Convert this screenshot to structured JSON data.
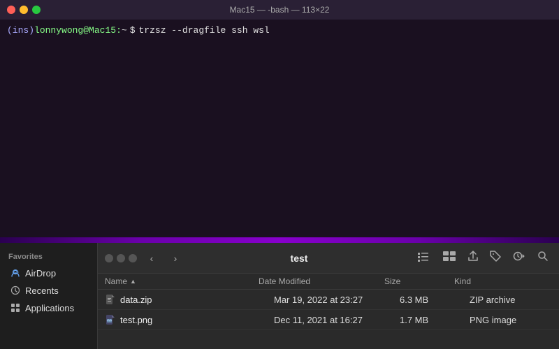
{
  "terminal": {
    "title": "Mac15 — -bash — 113×22",
    "prompt_ins": "(ins)",
    "prompt_user": "lonnywong",
    "prompt_at": "@",
    "prompt_host": "Mac15",
    "prompt_colon": ":",
    "prompt_tilde": "~",
    "prompt_dollar": "$",
    "command": "trzsz --dragfile ssh wsl"
  },
  "traffic_lights": {
    "close": "#ff5f57",
    "minimize": "#ffbd2e",
    "maximize": "#28c940"
  },
  "finder": {
    "toolbar": {
      "path": "test"
    },
    "sidebar": {
      "favorites_label": "Favorites",
      "items": [
        {
          "label": "AirDrop",
          "icon": "airdrop"
        },
        {
          "label": "Recents",
          "icon": "clock"
        },
        {
          "label": "Applications",
          "icon": "apps"
        }
      ]
    },
    "file_list": {
      "columns": {
        "name": "Name",
        "date_modified": "Date Modified",
        "size": "Size",
        "kind": "Kind"
      },
      "files": [
        {
          "name": "data.zip",
          "date_modified": "Mar 19, 2022 at 23:27",
          "size": "6.3 MB",
          "kind": "ZIP archive"
        },
        {
          "name": "test.png",
          "date_modified": "Dec 11, 2021 at 16:27",
          "size": "1.7 MB",
          "kind": "PNG image"
        }
      ]
    }
  }
}
